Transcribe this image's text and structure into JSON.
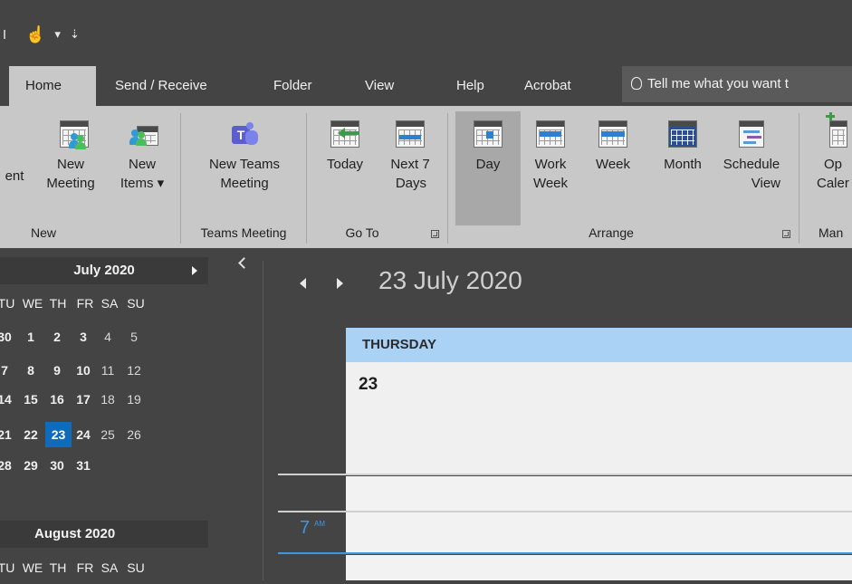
{
  "qat": {
    "touch_mode_label": "☝",
    "dropdown": "▾",
    "customize": "⇣"
  },
  "tabs": [
    {
      "label": "Home",
      "active": true
    },
    {
      "label": "Send / Receive"
    },
    {
      "label": "Folder"
    },
    {
      "label": "View"
    },
    {
      "label": "Help"
    },
    {
      "label": "Acrobat"
    }
  ],
  "tell_me": {
    "text": "Tell me what you want t",
    "icon": "lightbulb-icon"
  },
  "ribbon": {
    "new_group": {
      "label": "New",
      "new_appointment": "ent",
      "new_meeting_line1": "New",
      "new_meeting_line2": "Meeting",
      "new_items_line1": "New",
      "new_items_line2": "Items ▾"
    },
    "teams_group": {
      "label": "Teams Meeting",
      "button_line1": "New Teams",
      "button_line2": "Meeting"
    },
    "goto_group": {
      "label": "Go To",
      "today": "Today",
      "next7_line1": "Next 7",
      "next7_line2": "Days"
    },
    "arrange_group": {
      "label": "Arrange",
      "day": "Day",
      "work_week_line1": "Work",
      "work_week_line2": "Week",
      "week": "Week",
      "month": "Month",
      "schedule_line1": "Schedule",
      "schedule_line2": "View"
    },
    "manage_group": {
      "label": "Man",
      "open_line1": "Op",
      "open_line2": "Caler"
    }
  },
  "navigator": {
    "months": [
      {
        "title": "July 2020",
        "dow": [
          "TU",
          "WE",
          "TH",
          "FR",
          "SA",
          "SU"
        ],
        "weeks": [
          [
            "30",
            "1",
            "2",
            "3",
            "4",
            "5"
          ],
          [
            "7",
            "8",
            "9",
            "10",
            "11",
            "12"
          ],
          [
            "14",
            "15",
            "16",
            "17",
            "18",
            "19"
          ],
          [
            "21",
            "22",
            "23",
            "24",
            "25",
            "26"
          ],
          [
            "28",
            "29",
            "30",
            "31",
            "",
            ""
          ]
        ]
      },
      {
        "title": "August 2020",
        "dow": [
          "TU",
          "WE",
          "TH",
          "FR",
          "SA",
          "SU"
        ]
      }
    ],
    "today": "23"
  },
  "calendar": {
    "date_title": "23 July 2020",
    "day_name": "THURSDAY",
    "day_number": "23",
    "hour_label": "7",
    "hour_ampm": "AM"
  },
  "colors": {
    "accent": "#0f6cbd",
    "day_header": "#a9d2f5",
    "timeline": "#3f97e3",
    "ribbon_bg": "#c8c8c8",
    "chrome_bg": "#444444"
  }
}
